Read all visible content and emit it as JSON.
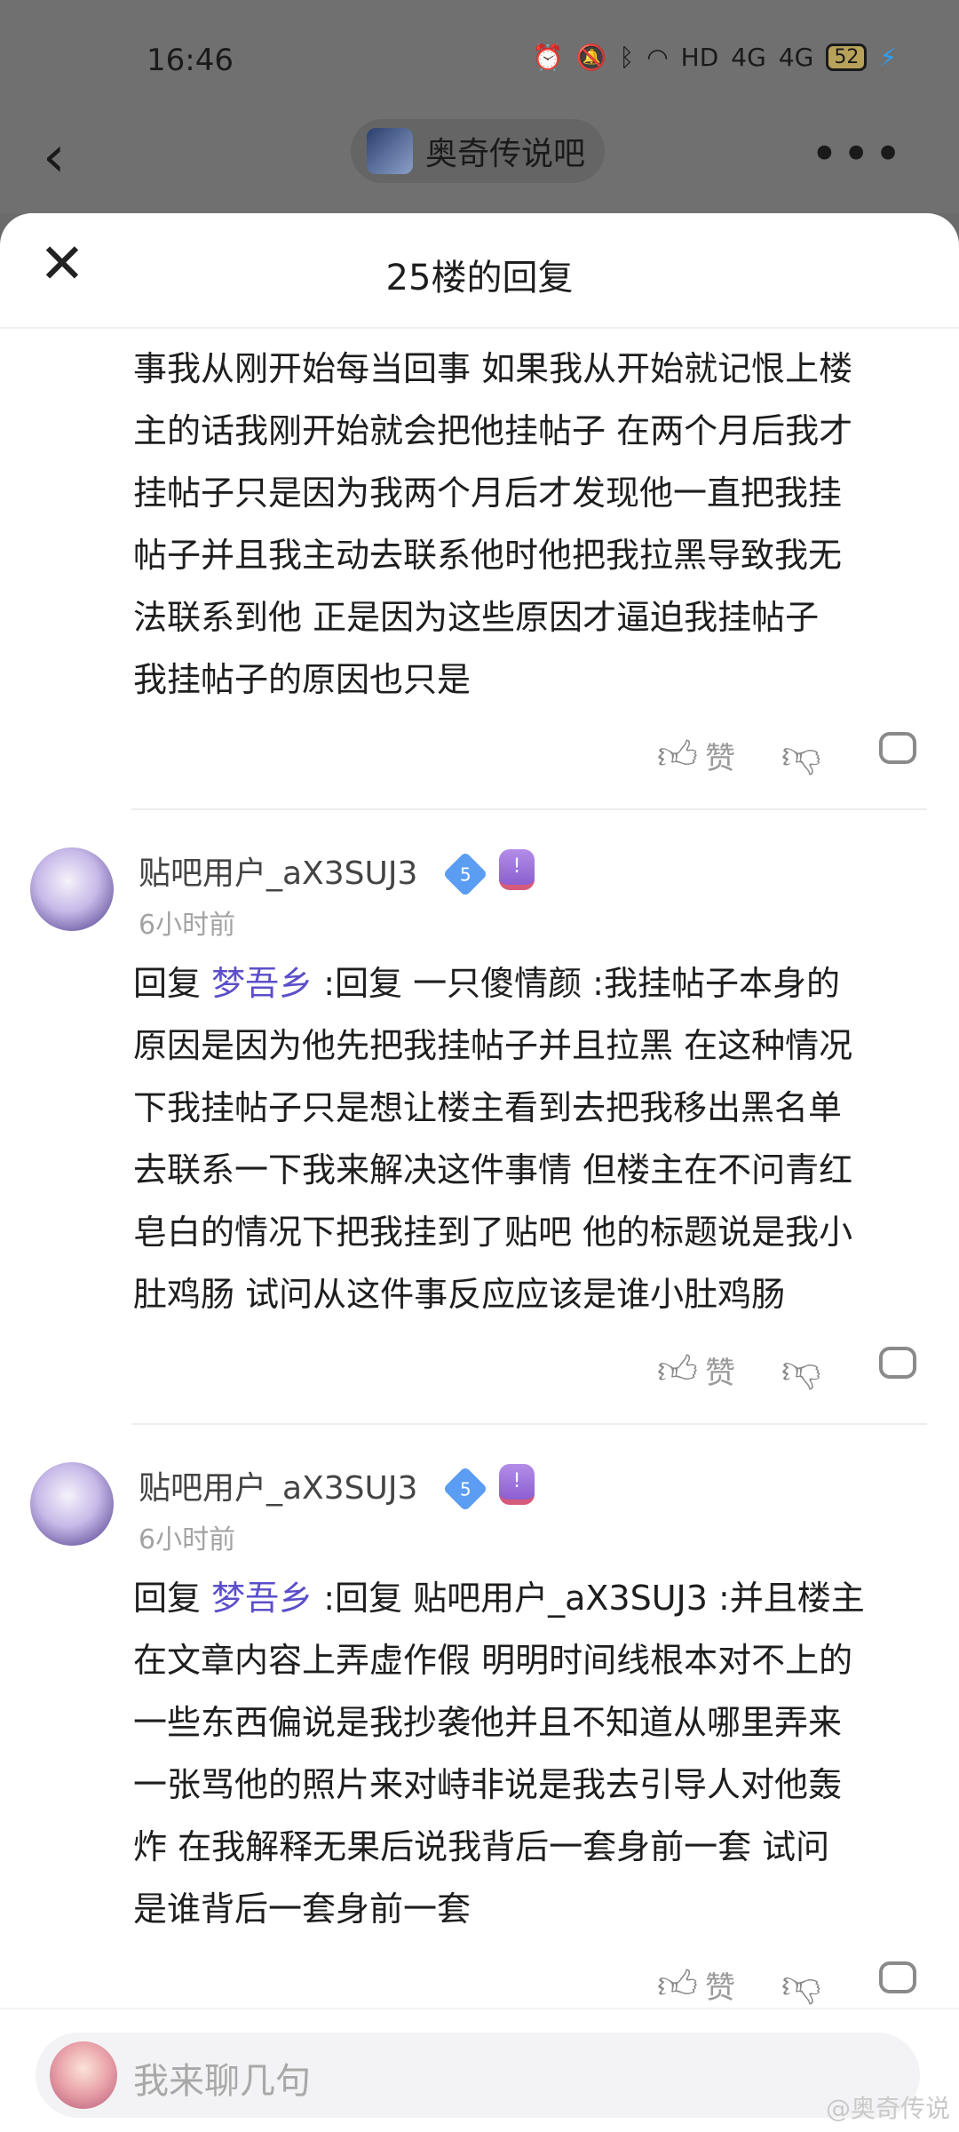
{
  "status_bar": {
    "time": "16:46",
    "network": "HD",
    "signal_1": "4G",
    "signal_2": "4G",
    "battery": "52"
  },
  "nav": {
    "back_icon": "chevron-left-icon",
    "forum_name": "奥奇传说吧",
    "more_icon": "more-horizontal-icon"
  },
  "sheet": {
    "title": "25楼的回复",
    "close_icon": "close-icon"
  },
  "first_reply": {
    "lines": [
      "事我从刚开始每当回事 如果我从开始就记恨上楼",
      "主的话我刚开始就会把他挂帖子 在两个月后我才",
      "挂帖子只是因为我两个月后才发现他一直把我挂",
      "帖子并且我主动去联系他时他把我拉黑导致我无",
      "法联系到他 正是因为这些原因才逼迫我挂帖子",
      "我挂帖子的原因也只是"
    ],
    "like_label": "赞"
  },
  "replies": [
    {
      "username": "贴吧用户_aX3SUJ3",
      "vip_level": "5",
      "time": "6小时前",
      "reply_prefix": "回复",
      "reply_to": "梦吾乡",
      "first_line_rest": " :回复 一只傻情颜 :我挂帖子本身的",
      "lines": [
        "原因是因为他先把我挂帖子并且拉黑 在这种情况",
        "下我挂帖子只是想让楼主看到去把我移出黑名单",
        "去联系一下我来解决这件事情 但楼主在不问青红",
        "皂白的情况下把我挂到了贴吧 他的标题说是我小",
        "肚鸡肠 试问从这件事反应应该是谁小肚鸡肠"
      ],
      "like_label": "赞"
    },
    {
      "username": "贴吧用户_aX3SUJ3",
      "vip_level": "5",
      "time": "6小时前",
      "reply_prefix": "回复",
      "reply_to": "梦吾乡",
      "first_line_rest": " :回复 贴吧用户_aX3SUJ3 :并且楼主",
      "lines": [
        "在文章内容上弄虚作假 明明时间线根本对不上的",
        "一些东西偏说是我抄袭他并且不知道从哪里弄来",
        "一张骂他的照片来对峙非说是我去引导人对他轰",
        "炸 在我解释无果后说我背后一套身前一套 试问",
        "是谁背后一套身前一套"
      ],
      "like_label": "赞"
    }
  ],
  "composer": {
    "placeholder": "我来聊几句"
  },
  "watermark": "@奥奇传说"
}
